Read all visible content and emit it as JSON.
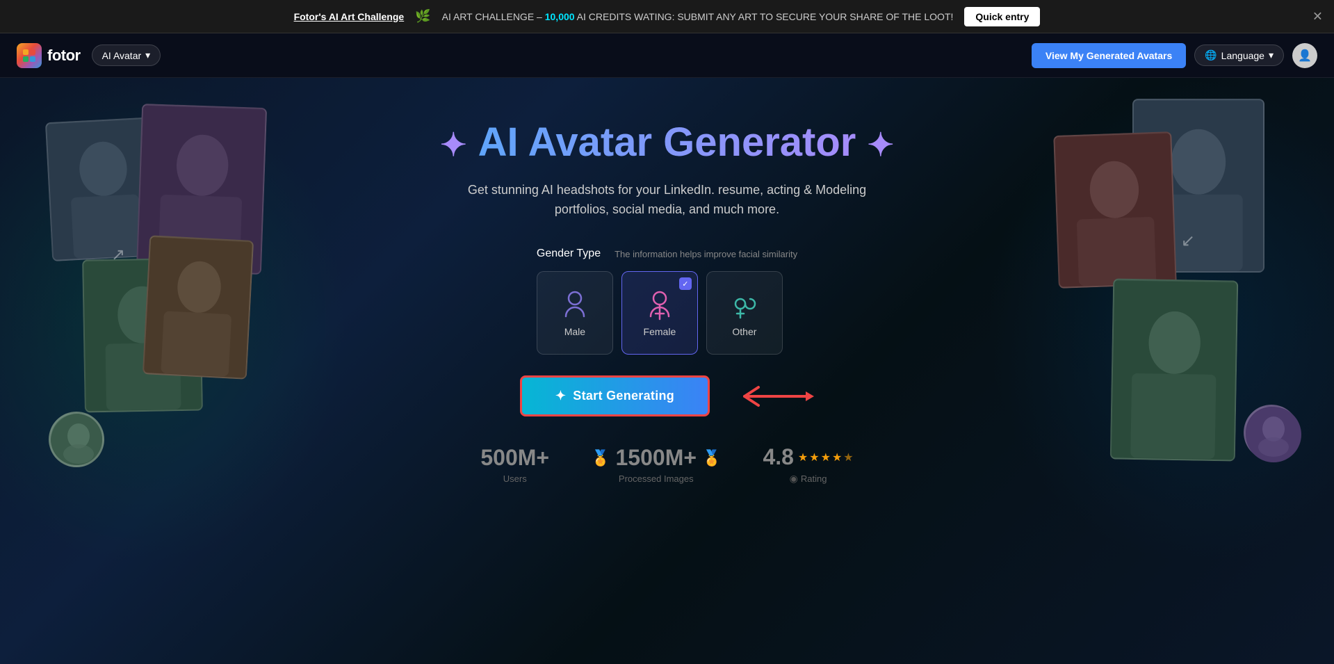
{
  "banner": {
    "challenge_text": "Fotor's AI Art Challenge",
    "description_prefix": "AI ART CHALLENGE – ",
    "credits_amount": "10,000",
    "description_suffix": " AI CREDITS WATING: SUBMIT ANY ART TO SECURE YOUR SHARE OF THE LOOT!",
    "quick_entry_label": "Quick entry",
    "close_label": "✕"
  },
  "header": {
    "logo_text": "fotor",
    "ai_avatar_label": "AI Avatar",
    "view_avatars_label": "View My Generated Avatars",
    "language_label": "Language"
  },
  "hero": {
    "sparkle_left": "✦",
    "sparkle_right": "✦",
    "title_ai": "AI Avatar Generator",
    "subtitle": "Get stunning AI headshots for your LinkedIn. resume, acting & Modeling portfolios, social media, and much more.",
    "gender_label": "Gender Type",
    "gender_hint": "The information helps improve facial similarity",
    "genders": [
      {
        "id": "male",
        "label": "Male",
        "selected": false
      },
      {
        "id": "female",
        "label": "Female",
        "selected": true
      },
      {
        "id": "other",
        "label": "Other",
        "selected": false
      }
    ],
    "start_btn_label": "Start Generating",
    "start_btn_icon": "✦"
  },
  "stats": [
    {
      "number": "500M+",
      "label": "Users",
      "icon": null
    },
    {
      "number": "1500M+",
      "label": "Processed Images",
      "icon": "laurel"
    },
    {
      "number": "4.8",
      "label": "Rating",
      "icon": "stars"
    }
  ],
  "colors": {
    "accent_blue": "#3b82f6",
    "accent_purple": "#6366f1",
    "accent_cyan": "#06b6d4",
    "female_pink": "#e060b0",
    "male_purple": "#7c6fd4",
    "other_teal": "#3db8a8",
    "highlight_cyan": "#00e5ff",
    "star_gold": "#f59e0b",
    "arrow_red": "#ef4444"
  }
}
